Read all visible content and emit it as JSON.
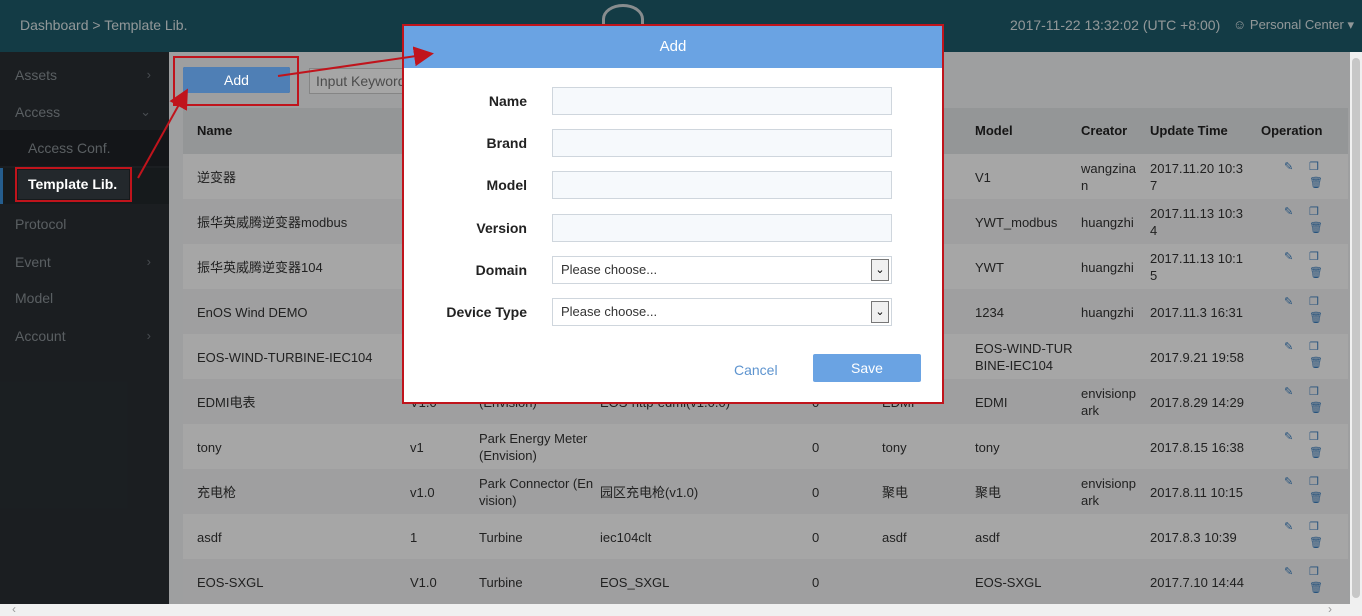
{
  "header": {
    "breadcrumb": "Dashboard > Template Lib.",
    "datetime": "2017-11-22 13:32:02 (UTC +8:00)",
    "personal": "Personal Center"
  },
  "sidebar": {
    "items": [
      {
        "label": "Assets"
      },
      {
        "label": "Access"
      },
      {
        "label": "Access Conf."
      },
      {
        "label": "Template Lib."
      },
      {
        "label": "Protocol"
      },
      {
        "label": "Event"
      },
      {
        "label": "Model"
      },
      {
        "label": "Account"
      }
    ]
  },
  "toolbar": {
    "add_label": "Add",
    "keyword_placeholder": "Input Keyword"
  },
  "table": {
    "headers": {
      "name": "Name",
      "model": "Model",
      "creator": "Creator",
      "update_time": "Update Time",
      "operation": "Operation"
    },
    "rows": [
      {
        "name": "逆变器",
        "c2": "",
        "c3": "",
        "c4": "",
        "c5": "",
        "c6": "",
        "model": "V1",
        "creator": "wangzina\nn",
        "update": "2017.11.20 10:3\n7"
      },
      {
        "name": "振华英威腾逆变器modbus",
        "c2": "",
        "c3": "",
        "c4": "",
        "c5": "",
        "c6": "",
        "model": "YWT_modbus",
        "creator": "huangzhi",
        "update": "2017.11.13 10:3\n4"
      },
      {
        "name": "振华英威腾逆变器104",
        "c2": "",
        "c3": "",
        "c4": "",
        "c5": "",
        "c6": "",
        "model": "YWT",
        "creator": "huangzhi",
        "update": "2017.11.13 10:1\n5"
      },
      {
        "name": "EnOS Wind DEMO",
        "c2": "",
        "c3": "",
        "c4": "",
        "c5": "",
        "c6": "",
        "model": "1234",
        "creator": "huangzhi",
        "update": "2017.11.3 16:31"
      },
      {
        "name": "EOS-WIND-TURBINE-IEC104",
        "c2": "",
        "c3": "",
        "c4": "",
        "c5": "",
        "c6": "",
        "model": "EOS-WIND-TUR\nBINE-IEC104",
        "creator": "",
        "update": "2017.9.21 19:58"
      },
      {
        "name": "EDMI电表",
        "c2": "V1.0",
        "c3": "(Envision)",
        "c4": "EOS-http-edmi(v1.0.0)",
        "c5": "0",
        "c6": "EDMI",
        "model": "EDMI",
        "creator": "envisionp\nark",
        "update": "2017.8.29 14:29"
      },
      {
        "name": "tony",
        "c2": "v1",
        "c3": "Park Energy Meter\n(Envision)",
        "c4": "",
        "c5": "0",
        "c6": "tony",
        "model": "tony",
        "creator": "",
        "update": "2017.8.15 16:38"
      },
      {
        "name": "充电枪",
        "c2": "v1.0",
        "c3": "Park Connector (En\nvision)",
        "c4": "园区充电枪(v1.0)",
        "c5": "0",
        "c6": "聚电",
        "model": "聚电",
        "creator": "envisionp\nark",
        "update": "2017.8.11 10:15"
      },
      {
        "name": "asdf",
        "c2": "1",
        "c3": "Turbine",
        "c4": "iec104clt",
        "c5": "0",
        "c6": "asdf",
        "model": "asdf",
        "creator": "",
        "update": "2017.8.3 10:39"
      },
      {
        "name": "EOS-SXGL",
        "c2": "V1.0",
        "c3": "Turbine",
        "c4": "EOS_SXGL",
        "c5": "0",
        "c6": "",
        "model": "EOS-SXGL",
        "creator": "",
        "update": "2017.7.10 14:44"
      }
    ]
  },
  "modal": {
    "title": "Add",
    "fields": {
      "name": "Name",
      "brand": "Brand",
      "model": "Model",
      "version": "Version",
      "domain": "Domain",
      "device_type": "Device Type"
    },
    "select_placeholder": "Please choose...",
    "cancel_label": "Cancel",
    "save_label": "Save"
  },
  "colors": {
    "header_bg": "#1e5b6b",
    "sidebar_bg": "#2a2f34",
    "modal_header": "#6aa3e3",
    "annotation_red": "#c0141c",
    "primary_button": "#4f7fb5"
  }
}
